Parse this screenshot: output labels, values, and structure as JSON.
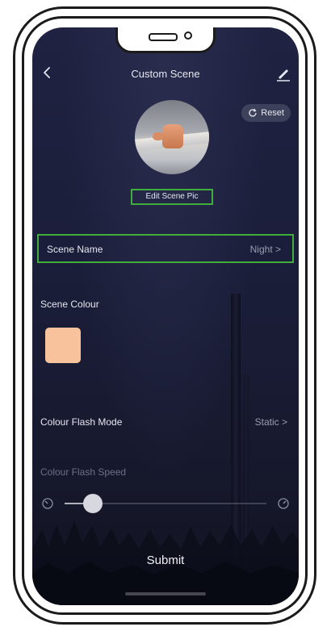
{
  "header": {
    "title": "Custom Scene",
    "back_icon": "chevron-left-icon",
    "edit_icon": "pencil-icon"
  },
  "reset": {
    "label": "Reset",
    "icon": "refresh-icon"
  },
  "scene_pic": {
    "edit_label": "Edit Scene Pic"
  },
  "rows": {
    "scene_name": {
      "label": "Scene Name",
      "value": "Night >"
    },
    "scene_colour": {
      "label": "Scene Colour",
      "swatch_color": "#f8c39c"
    },
    "colour_flash_mode": {
      "label": "Colour Flash Mode",
      "value": "Static >"
    },
    "colour_flash_speed": {
      "label": "Colour Flash Speed"
    }
  },
  "slider": {
    "level": 0.1,
    "min_icon": "speed-slow-icon",
    "max_icon": "speed-fast-icon"
  },
  "submit": {
    "label": "Submit"
  },
  "colors": {
    "highlight": "#3fae3a",
    "background": "#1d1f3a"
  }
}
